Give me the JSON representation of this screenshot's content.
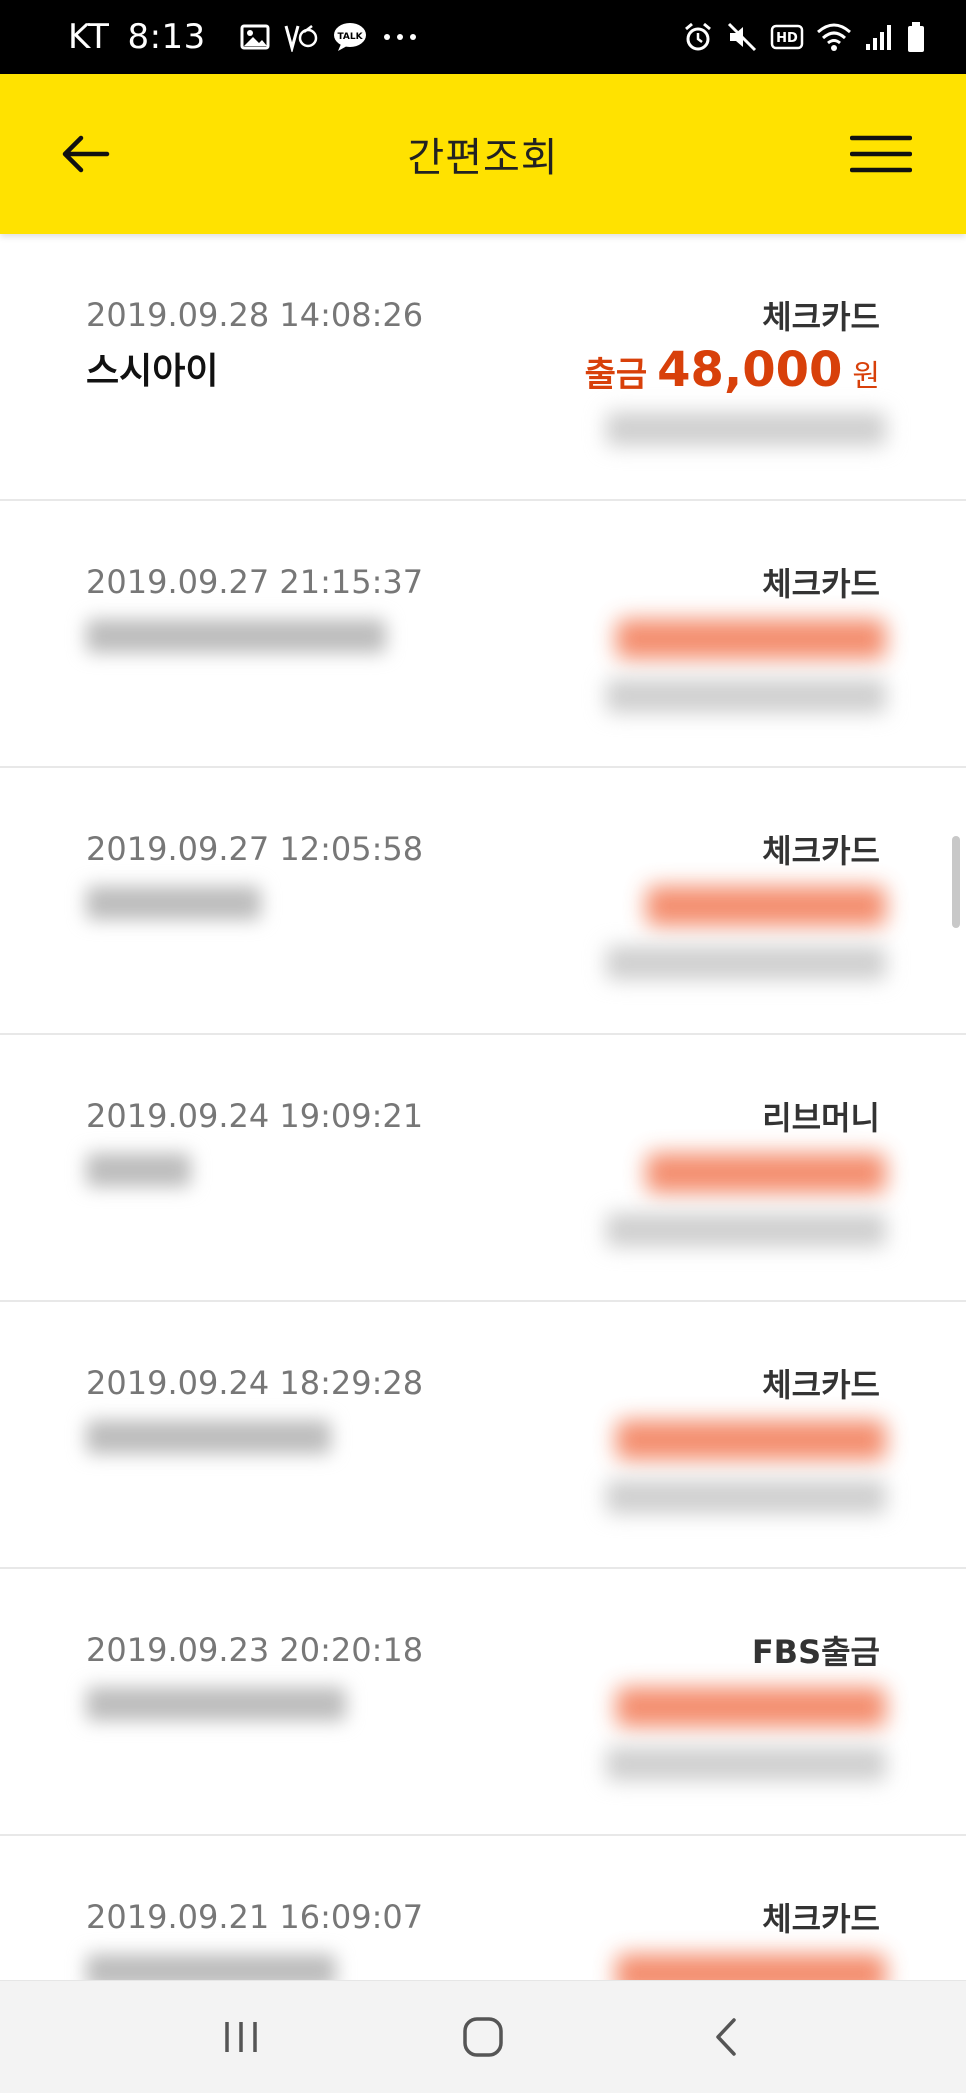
{
  "status_bar": {
    "carrier": "KT",
    "time": "8:13",
    "left_icons": [
      "image-icon",
      "voicemail-icon",
      "kakaotalk-icon",
      "more-dots-icon"
    ],
    "right_icons": [
      "alarm-icon",
      "mute-icon",
      "hd-icon",
      "wifi-icon",
      "signal-icon",
      "battery-icon"
    ]
  },
  "app_bar": {
    "title": "간편조회",
    "back_icon": "arrow-left-icon",
    "menu_icon": "hamburger-menu-icon"
  },
  "transactions": [
    {
      "datetime": "2019.09.28 14:08:26",
      "merchant": "스시아이",
      "type": "체크카드",
      "amount_label": "출금",
      "amount": "48,000",
      "unit": "원",
      "blurred": false
    },
    {
      "datetime": "2019.09.27 21:15:37",
      "merchant": "",
      "type": "체크카드",
      "blurred": true
    },
    {
      "datetime": "2019.09.27 12:05:58",
      "merchant": "",
      "type": "체크카드",
      "blurred": true
    },
    {
      "datetime": "2019.09.24 19:09:21",
      "merchant": "",
      "type": "리브머니",
      "blurred": true
    },
    {
      "datetime": "2019.09.24 18:29:28",
      "merchant": "",
      "type": "체크카드",
      "blurred": true
    },
    {
      "datetime": "2019.09.23 20:20:18",
      "merchant": "",
      "type": "FBS출금",
      "blurred": true
    },
    {
      "datetime": "2019.09.21 16:09:07",
      "merchant": "",
      "type": "체크카드",
      "blurred": true
    }
  ],
  "nav_bar": {
    "icons": [
      "recent-apps-icon",
      "home-icon",
      "back-icon"
    ]
  },
  "colors": {
    "app_bar": "#FFE200",
    "amount": "#D8400A",
    "status_bar": "#000000",
    "nav_bar": "#F3F3F3"
  }
}
